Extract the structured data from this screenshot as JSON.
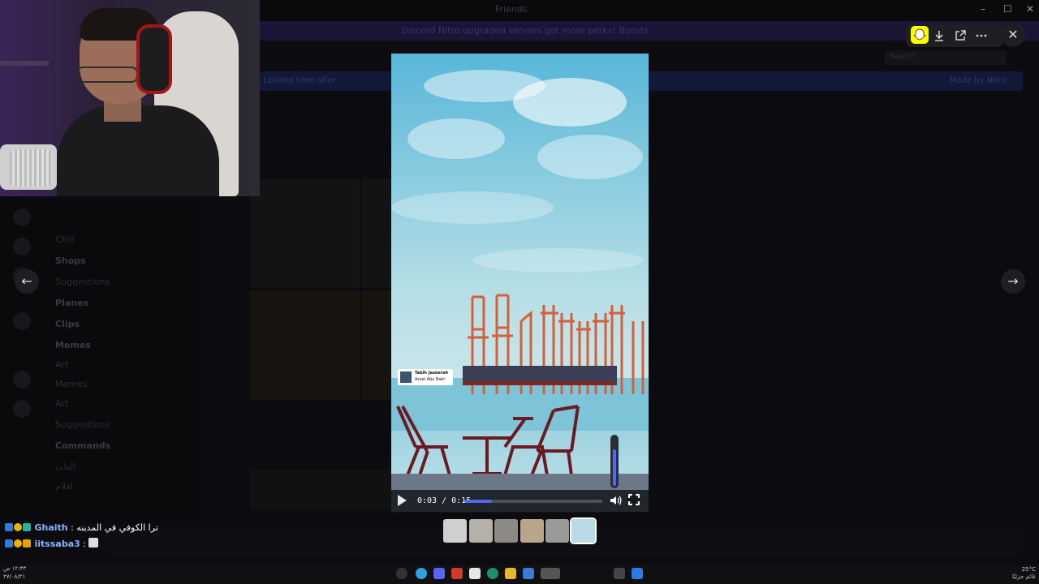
{
  "window": {
    "title": "Friends",
    "min_label": "–",
    "max_label": "☐",
    "close_label": "✕"
  },
  "banner": {
    "text": "Discord Nitro upgraded servers get more perks! Boosts"
  },
  "notice": {
    "left": "Limited time offer",
    "right": "Made by Nitro"
  },
  "header": {
    "search_placeholder": "Search"
  },
  "sidebar": {
    "channels": [
      {
        "label": "Chill",
        "bold": false
      },
      {
        "label": "Shops",
        "bold": true
      },
      {
        "label": "Suggestions",
        "bold": false
      },
      {
        "label": "Planes",
        "bold": true
      },
      {
        "label": "Clips",
        "bold": true
      },
      {
        "label": "Memes",
        "bold": true
      },
      {
        "label": "Art",
        "bold": false
      },
      {
        "label": "Memes",
        "bold": false
      },
      {
        "label": "Art",
        "bold": false
      },
      {
        "label": "Suggestions",
        "bold": false
      },
      {
        "label": "Commands",
        "bold": true
      },
      {
        "label": "العاب",
        "bold": false
      },
      {
        "label": "افلام",
        "bold": false
      }
    ]
  },
  "chat": [
    {
      "user": "Ghaith",
      "message": "ترا الكوفي في المدينه"
    },
    {
      "user": "iitssaba3",
      "message": ""
    }
  ],
  "viewer": {
    "toolbar": {
      "download_icon": "download-icon",
      "open_icon": "open-external-icon",
      "more_icon": "more-icon"
    },
    "close_label": "✕",
    "prev_label": "←",
    "next_label": "→",
    "video": {
      "watermark_line1": "Tabih Jazeerah",
      "watermark_line2": "Assel Abu Bakr",
      "time_display": "0:03 / 0:15",
      "progress": 0.2,
      "volume": 0.75
    },
    "thumbnails": 6,
    "selected_thumbnail": 6
  },
  "taskbar": {
    "time": "١٢:٣٣ ص",
    "date": "٢٧/٠٨/٢١",
    "weather": "25°C",
    "weather_desc": "غائم جزئيًا"
  },
  "colors": {
    "accent": "#5865f2",
    "snapchat": "#fffc00"
  }
}
